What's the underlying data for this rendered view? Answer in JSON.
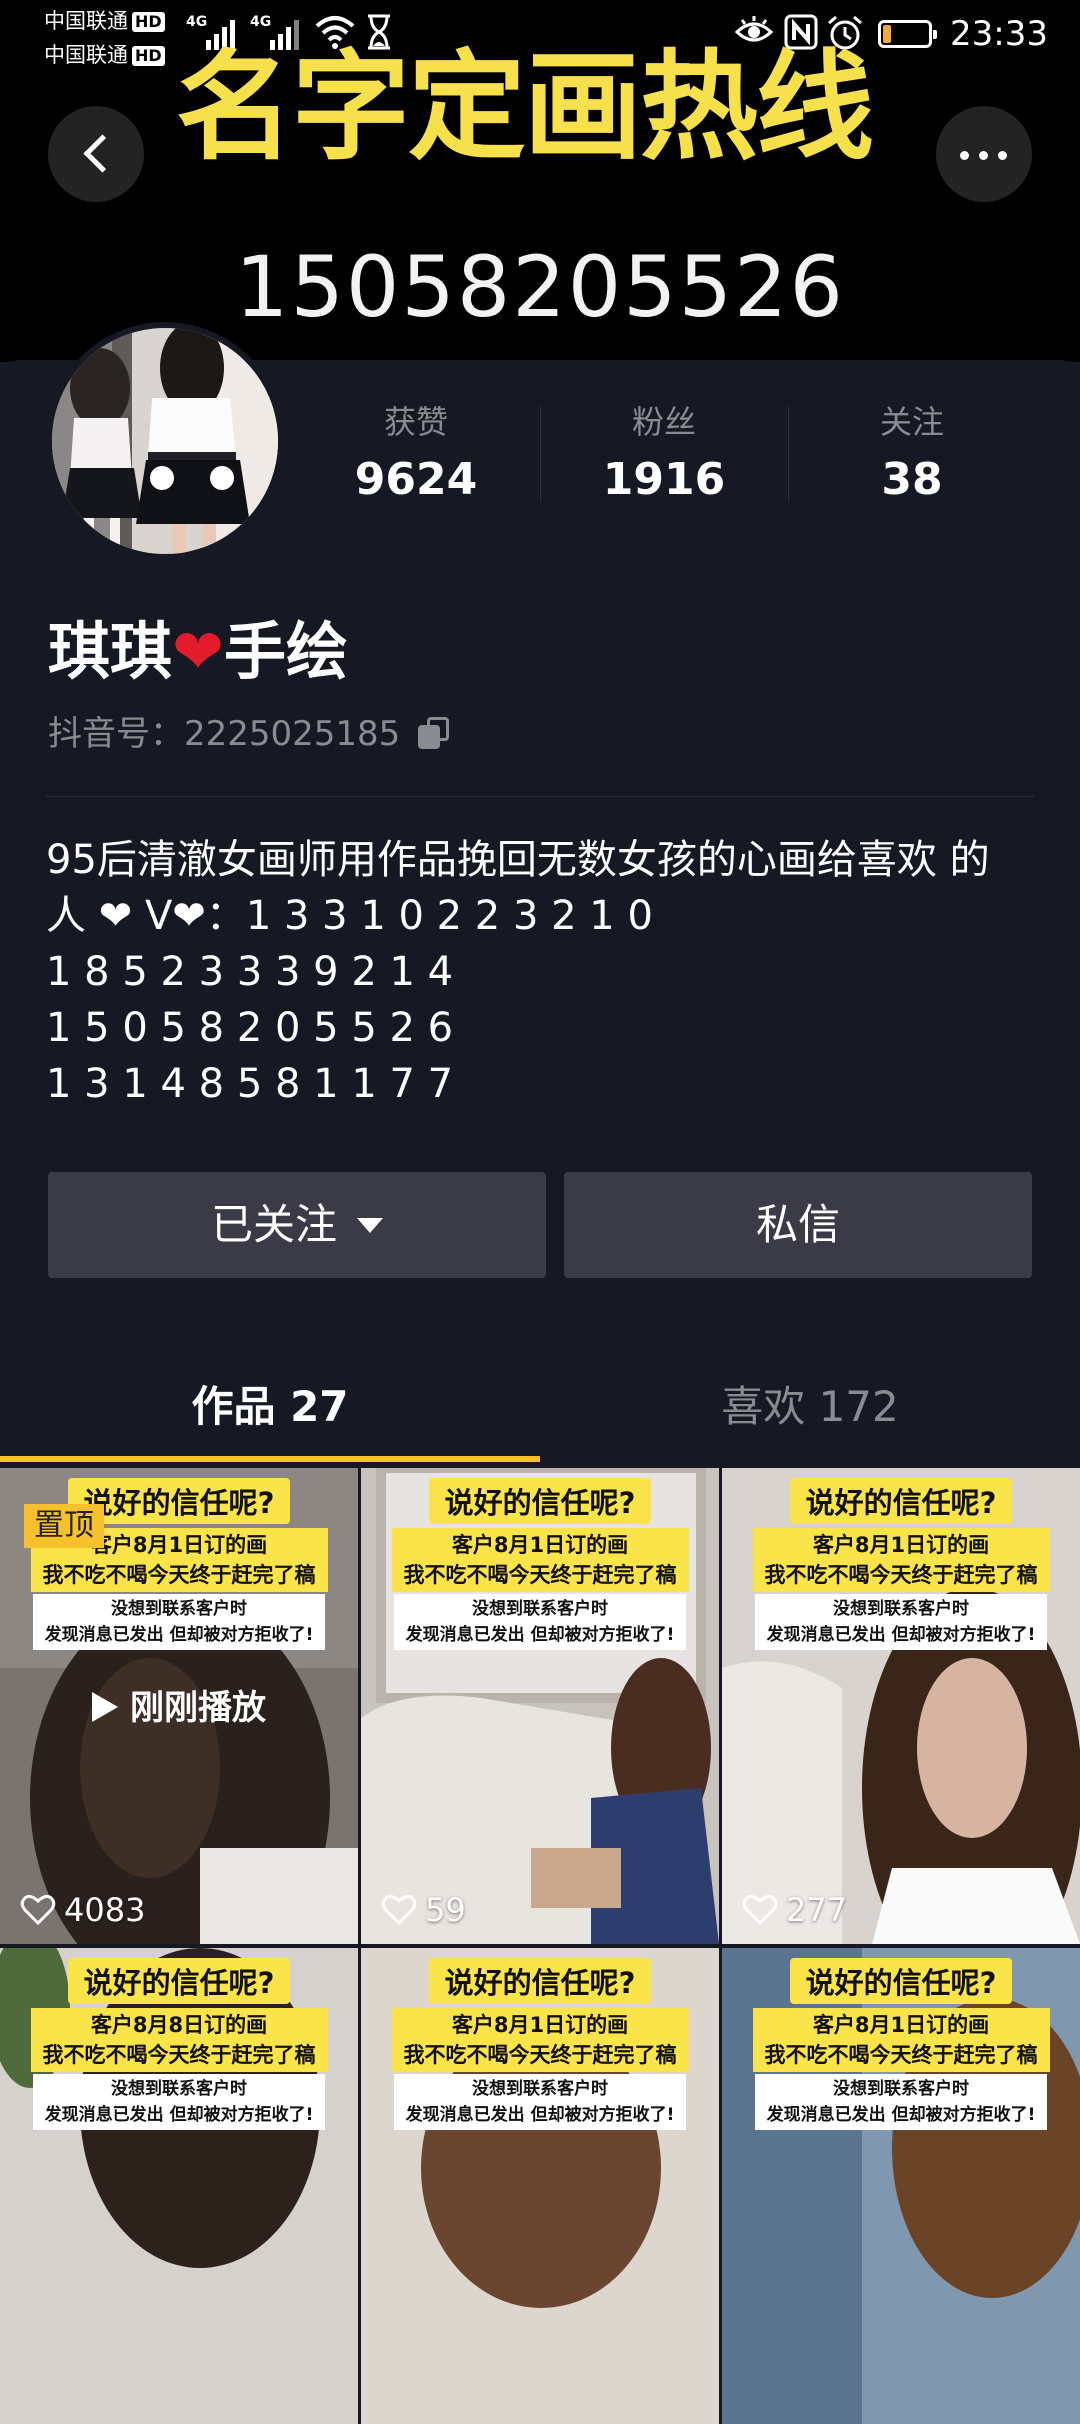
{
  "status_bar": {
    "carrier_1": "中国联通",
    "carrier_2": "中国联通",
    "hd_1": "HD",
    "hd_2": "HD",
    "net_1": "4G",
    "net_2": "4G",
    "battery_level": "17",
    "time": "23:33"
  },
  "banner": {
    "headline": "名字定画热线",
    "hotline": "15058205526"
  },
  "profile": {
    "stats": [
      {
        "label": "获赞",
        "value": "9624"
      },
      {
        "label": "粉丝",
        "value": "1916"
      },
      {
        "label": "关注",
        "value": "38"
      }
    ],
    "name_part1": "琪琪",
    "name_heart": "❤",
    "name_part2": "手绘",
    "douyin_id": "抖音号：2225025185",
    "bio_lines": [
      "95后清澈女画师用作品挽回无数女孩的心画给喜欢 的",
      "人 ❤ V❤：1 3 3 1 0 2 2 3 2 1 0",
      "1 8 5 2 3 3 3 9 2 1 4",
      "1 5 0 5 8 2 0 5 5 2 6",
      "1 3 1 4 8 5 8 1 1 7 7"
    ]
  },
  "actions": {
    "follow_label": "已关注",
    "message_label": "私信"
  },
  "tabs": {
    "works": "作品 27",
    "likes": "喜欢 172"
  },
  "accent_color": "#f6c12d",
  "videos": [
    {
      "title": "说好的信任呢?",
      "sub1": "客户8月1日订的画",
      "sub2": "我不吃不喝今天终于赶完了稿",
      "note1": "没想到联系客户时",
      "note2": "发现消息已发出 但却被对方拒收了!",
      "likes": "4083",
      "pinned_label": "置顶",
      "overlay": "刚刚播放"
    },
    {
      "title": "说好的信任呢?",
      "sub1": "客户8月1日订的画",
      "sub2": "我不吃不喝今天终于赶完了稿",
      "note1": "没想到联系客户时",
      "note2": "发现消息已发出 但却被对方拒收了!",
      "likes": "59"
    },
    {
      "title": "说好的信任呢?",
      "sub1": "客户8月1日订的画",
      "sub2": "我不吃不喝今天终于赶完了稿",
      "note1": "没想到联系客户时",
      "note2": "发现消息已发出 但却被对方拒收了!",
      "likes": "277"
    },
    {
      "title": "说好的信任呢?",
      "sub1": "客户8月8日订的画",
      "sub2": "我不吃不喝今天终于赶完了稿",
      "note1": "没想到联系客户时",
      "note2": "发现消息已发出 但却被对方拒收了!"
    },
    {
      "title": "说好的信任呢?",
      "sub1": "客户8月1日订的画",
      "sub2": "我不吃不喝今天终于赶完了稿",
      "note1": "没想到联系客户时",
      "note2": "发现消息已发出 但却被对方拒收了!"
    },
    {
      "title": "说好的信任呢?",
      "sub1": "客户8月1日订的画",
      "sub2": "我不吃不喝今天终于赶完了稿",
      "note1": "没想到联系客户时",
      "note2": "发现消息已发出 但却被对方拒收了!"
    }
  ]
}
